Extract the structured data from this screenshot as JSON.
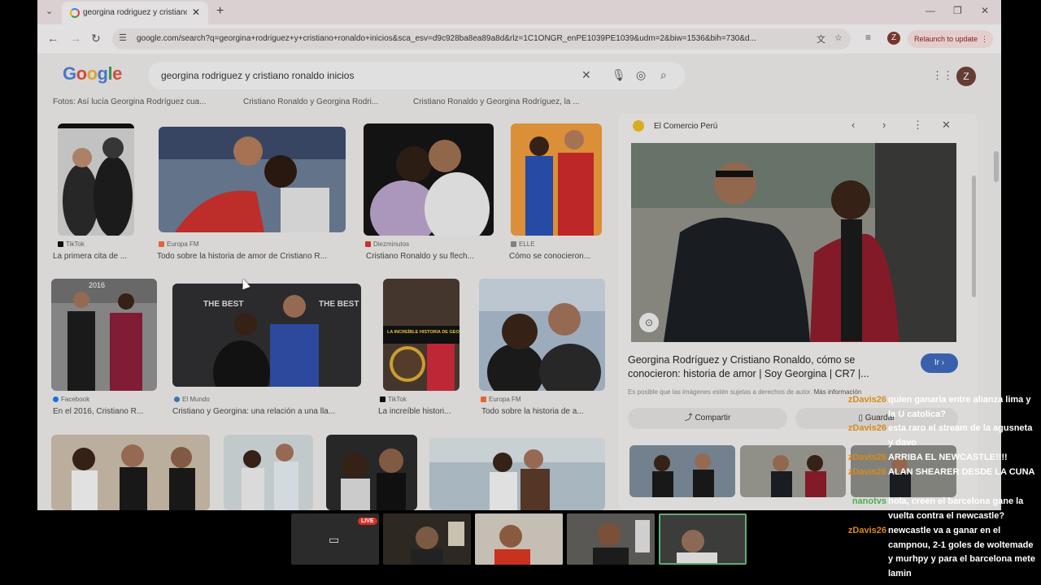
{
  "browser": {
    "tab_title": "georgina rodriguez y cristiano",
    "url": "google.com/search?q=georgina+rodriguez+y+cristiano+ronaldo+inicios&sca_esv=d9c928ba8ea89a8d&rlz=1C1ONGR_enPE1039PE1039&udm=2&biw=1536&bih=730&d...",
    "profile_initial": "Z",
    "relaunch_label": "Relaunch to update"
  },
  "google": {
    "logo": "Google",
    "query": "georgina rodriguez y cristiano ronaldo inicios",
    "profile_initial": "Z",
    "top_captions": [
      "Fotos: Así lucía Georgina Rodríguez cua...",
      "Cristiano Ronaldo y Georgina Rodri...",
      "Cristiano Ronaldo y Georgina Rodríguez, la ..."
    ],
    "results_row1": [
      {
        "source": "TikTok",
        "caption": "La primera cita de ...",
        "color": "#111111"
      },
      {
        "source": "Europa FM",
        "caption": "Todo sobre la historia de amor de Cristiano R...",
        "color": "#f26b38"
      },
      {
        "source": "Diezminutos",
        "caption": "Cristiano Ronaldo y su flech...",
        "color": "#d9342b"
      },
      {
        "source": "ELLE",
        "caption": "Cómo se conocieron...",
        "color": "#888888"
      }
    ],
    "results_row2": [
      {
        "source": "Facebook",
        "caption": "En el 2016, Cristiano R...",
        "color": "#1877f2"
      },
      {
        "source": "El Mundo",
        "caption": "Cristiano y Georgina: una relación a una lla...",
        "color": "#3b7dc4"
      },
      {
        "source": "TikTok",
        "caption": "La increíble histori...",
        "color": "#111111"
      },
      {
        "source": "Europa FM",
        "caption": "Todo sobre la historia de a...",
        "color": "#f26b38"
      }
    ],
    "thumb_overlay_year": "2016",
    "thumb_overlay_banner": "LA INCREÍBLE HISTORIA DE GEORGINA RODRÍGUEZ",
    "the_best": "THE BEST"
  },
  "panel": {
    "source": "El Comercio Perú",
    "title": "Georgina Rodríguez y Cristiano Ronaldo, cómo se conocieron: historia de amor | Soy Georgina | CR7 |...",
    "go_label": "Ir",
    "disclaimer": "Es posible que las imágenes estén sujetas a derechos de autor.",
    "more_info": "Más información",
    "share_label": "Compartir",
    "save_label": "Guardar"
  },
  "meet": {
    "live_badge": "LIVE"
  },
  "chat": [
    {
      "user": "zDavis26",
      "text": "quien ganaria entre alianza lima y la U catolica?",
      "color": "#d98a1a"
    },
    {
      "user": "zDavis26",
      "text": "esta raro el stream de la agusneta y davo",
      "color": "#d98a1a"
    },
    {
      "user": "zDavis26",
      "text": "ARRIBA EL NEWCASTLE!!!!",
      "color": "#d98a1a"
    },
    {
      "user": "zDavis26",
      "text": "ALAN SHEARER DESDE LA CUNA",
      "color": "#d98a1a"
    },
    {
      "user": "nanotvs",
      "text": "hola, creen el barcelona gane la vuelta contra el newcastle?",
      "color": "#4caf50"
    },
    {
      "user": "zDavis26",
      "text": "newcastle va a ganar en el campnou, 2-1 goles de woltemade y murhpy y para el barcelona mete lamin",
      "color": "#d98a1a"
    }
  ]
}
